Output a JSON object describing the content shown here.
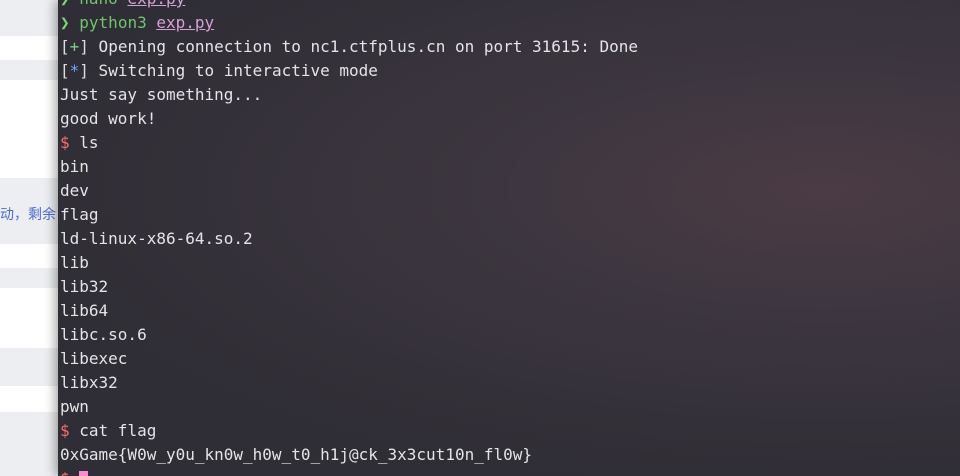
{
  "background_page": {
    "snippet_text": "动，剩余"
  },
  "terminal": {
    "lines": [
      {
        "kind": "prompt",
        "arrow": "❯",
        "cmd": "nano",
        "arg": "exp.py"
      },
      {
        "kind": "prompt",
        "arrow": "❯",
        "cmd": "python3",
        "arg": "exp.py"
      },
      {
        "kind": "status",
        "symbol": "+",
        "text": " Opening connection to nc1.ctfplus.cn on port 31615: Done"
      },
      {
        "kind": "status",
        "symbol": "*",
        "text": " Switching to interactive mode"
      },
      {
        "kind": "output",
        "text": "Just say something..."
      },
      {
        "kind": "output",
        "text": "good work!"
      },
      {
        "kind": "shell",
        "dollar": "$",
        "text": " ls"
      },
      {
        "kind": "output",
        "text": "bin"
      },
      {
        "kind": "output",
        "text": "dev"
      },
      {
        "kind": "output",
        "text": "flag"
      },
      {
        "kind": "output",
        "text": "ld-linux-x86-64.so.2"
      },
      {
        "kind": "output",
        "text": "lib"
      },
      {
        "kind": "output",
        "text": "lib32"
      },
      {
        "kind": "output",
        "text": "lib64"
      },
      {
        "kind": "output",
        "text": "libc.so.6"
      },
      {
        "kind": "output",
        "text": "libexec"
      },
      {
        "kind": "output",
        "text": "libx32"
      },
      {
        "kind": "output",
        "text": "pwn"
      },
      {
        "kind": "shell",
        "dollar": "$",
        "text": " cat flag"
      },
      {
        "kind": "output",
        "text": "0xGame{W0w_y0u_kn0w_h0w_t0_h1j@ck_3x3cut10n_fl0w}"
      },
      {
        "kind": "cursor",
        "dollar": "$"
      }
    ],
    "colors": {
      "prompt_arrow": "#7dd87d",
      "status_plus": "#7ed07e",
      "status_star": "#6fa8ff",
      "shell_dollar": "#ff6b6b",
      "path": "#d4a2d6",
      "cursor": "#ff8bd5"
    }
  }
}
